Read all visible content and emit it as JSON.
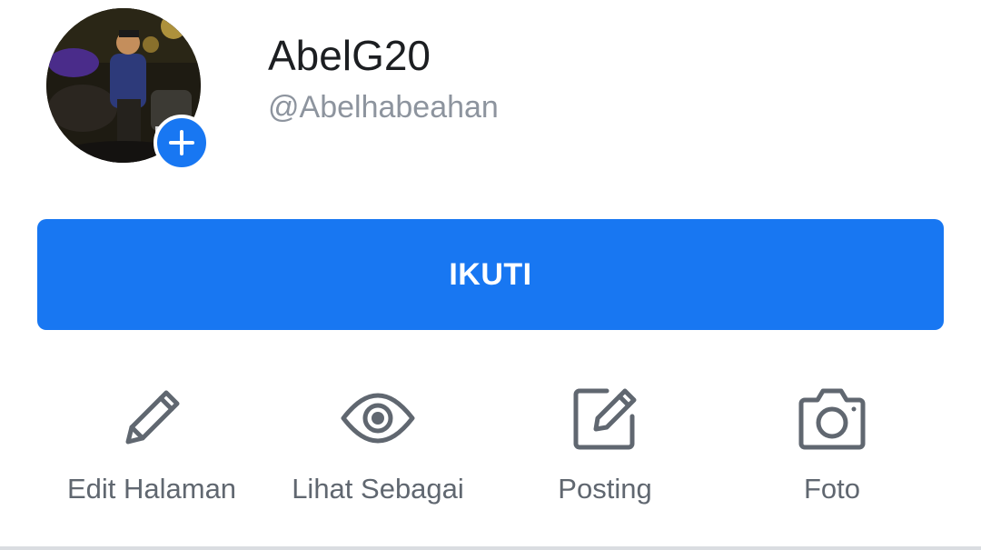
{
  "profile": {
    "name": "AbelG20",
    "handle": "@Abelhabeahan"
  },
  "follow_button": {
    "label": "IKUTI"
  },
  "actions": [
    {
      "label": "Edit Halaman",
      "icon": "pencil-icon"
    },
    {
      "label": "Lihat Sebagai",
      "icon": "eye-icon"
    },
    {
      "label": "Posting",
      "icon": "compose-icon"
    },
    {
      "label": "Foto",
      "icon": "camera-icon"
    }
  ],
  "colors": {
    "accent": "#1877f2",
    "icon_gray": "#606770",
    "handle_gray": "#8d949e"
  }
}
